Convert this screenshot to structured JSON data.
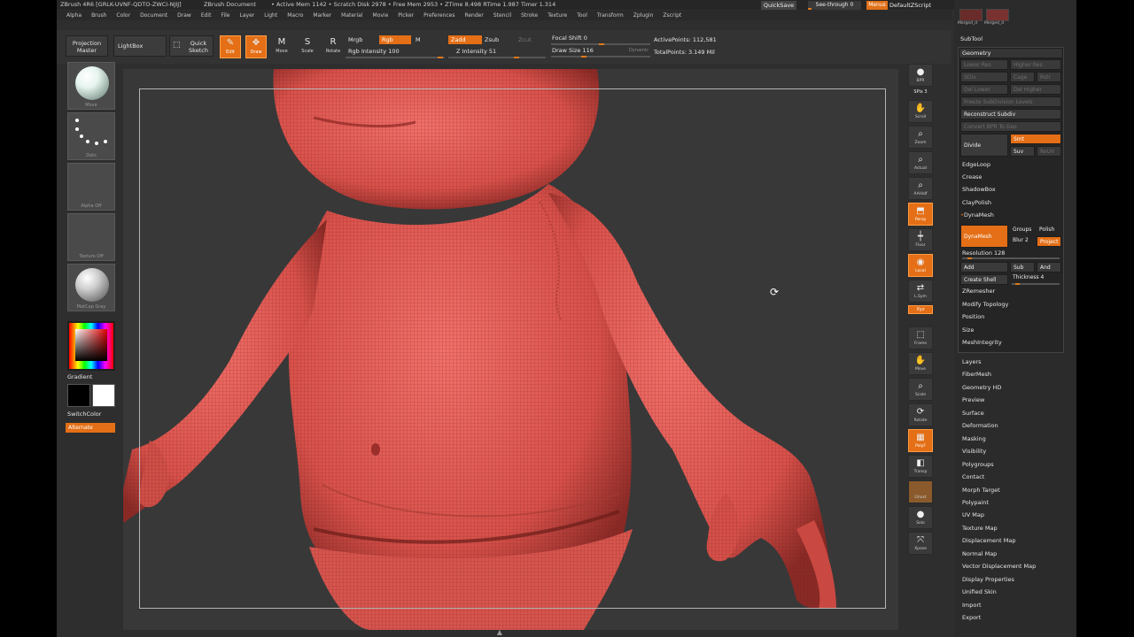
{
  "titlebar": {
    "app": "ZBrush 4R6 [GRLK-UVNF-QDTO-ZWCI-NJIJ]",
    "doc": "ZBrush Document",
    "mem": "• Active Mem 1142 • Scratch Disk 2978 • Free Mem 2953 • ZTime 8.498 RTime 1.987 Timer 1.314",
    "quicksave": "QuickSave",
    "seethrough": "See-through  0",
    "menus": "Menus",
    "defscript": "DefaultZScript",
    "winctl": "- ▫ ×"
  },
  "menubar": [
    "Alpha",
    "Brush",
    "Color",
    "Document",
    "Draw",
    "Edit",
    "File",
    "Layer",
    "Light",
    "Macro",
    "Marker",
    "Material",
    "Movie",
    "Picker",
    "Preferences",
    "Render",
    "Stencil",
    "Stroke",
    "Texture",
    "Tool",
    "Transform",
    "Zplugin",
    "Zscript"
  ],
  "shelf": {
    "projection_master": "Projection Master",
    "lightbox": "LightBox",
    "quick_sketch": "Quick Sketch",
    "tools": [
      {
        "label": "Edit",
        "icon": "✎",
        "active": true
      },
      {
        "label": "Draw",
        "icon": "✥",
        "active": true
      },
      {
        "label": "Move",
        "icon": "M",
        "active": false
      },
      {
        "label": "Scale",
        "icon": "S",
        "active": false
      },
      {
        "label": "Rotate",
        "icon": "R",
        "active": false
      }
    ],
    "mrgb": "Mrgb",
    "rgb": "Rgb",
    "m": "M",
    "rgb_intensity": "Rgb Intensity 100",
    "zadd": "Zadd",
    "zsub": "Zsub",
    "zcut": "Zcut",
    "z_intensity": "Z Intensity 51",
    "focal_shift": "Focal Shift 0",
    "draw_size": "Draw Size 116",
    "dynamic": "Dynamic",
    "active_points": "ActivePoints: 112,581",
    "total_points": "TotalPoints: 3.149 Mil"
  },
  "leftshelf": {
    "brush": "Move",
    "stroke": "Dots",
    "alpha": "Alpha Off",
    "texture": "Texture Off",
    "material": "MatCap Gray",
    "gradient": "Gradient",
    "switchcolor": "SwitchColor",
    "alternate": "Alternate"
  },
  "rightcol": [
    {
      "label": "BPR",
      "icon": "●",
      "state": "normal"
    },
    {
      "label": "SPix 3",
      "icon": "",
      "state": "text"
    },
    {
      "label": "Scroll",
      "icon": "✋",
      "state": "normal"
    },
    {
      "label": "Zoom",
      "icon": "⌕",
      "state": "normal"
    },
    {
      "label": "Actual",
      "icon": "⌕",
      "state": "normal"
    },
    {
      "label": "AAHalf",
      "icon": "⌕",
      "state": "normal"
    },
    {
      "label": "Persp",
      "icon": "⬒",
      "state": "orange"
    },
    {
      "label": "Floor",
      "icon": "┿",
      "state": "normal"
    },
    {
      "label": "Local",
      "icon": "◉",
      "state": "orange"
    },
    {
      "label": "L.Sym",
      "icon": "⇄",
      "state": "normal"
    },
    {
      "label": "Xyz",
      "icon": "",
      "state": "orange-small"
    },
    {
      "label": "Frame",
      "icon": "⬚",
      "state": "normal"
    },
    {
      "label": "Move",
      "icon": "✋",
      "state": "normal"
    },
    {
      "label": "Scale",
      "icon": "⌕",
      "state": "normal"
    },
    {
      "label": "Rotate",
      "icon": "⟳",
      "state": "normal"
    },
    {
      "label": "PolyF",
      "icon": "▦",
      "state": "orange"
    },
    {
      "label": "Transp",
      "icon": "◧",
      "state": "normal"
    },
    {
      "label": "Ghost",
      "icon": "",
      "state": "brown"
    },
    {
      "label": "Solo",
      "icon": "●",
      "state": "normal"
    },
    {
      "label": "Xpose",
      "icon": "⤧",
      "state": "normal"
    }
  ],
  "palette": {
    "merged1": "Merged_d",
    "merged2": "Merged_d",
    "subtool": "SubTool",
    "geometry": "Geometry",
    "lower_res": "Lower Res",
    "higher_res": "Higher Res",
    "sdiv": "SDiv",
    "cage": "Cage",
    "rstr": "Rstr",
    "del_lower": "Del Lower",
    "del_higher": "Del Higher",
    "freeze": "Freeze SubDivision Levels",
    "reconstruct": "Reconstruct Subdiv",
    "convert_bpr": "Convert BPR To Geo",
    "divide": "Divide",
    "smt": "Smt",
    "suv": "Suv",
    "reuv": "ReUV",
    "edgeloop": "EdgeLoop",
    "crease": "Crease",
    "shadowbox": "ShadowBox",
    "claypolish": "ClayPolish",
    "dynamesh_hdr": "DynaMesh",
    "dynamesh_btn": "DynaMesh",
    "groups": "Groups",
    "polish": "Polish",
    "blur": "Blur 2",
    "project": "Project",
    "resolution": "Resolution 128",
    "add": "Add",
    "sub": "Sub",
    "and": "And",
    "create_shell": "Create Shell",
    "thickness": "Thickness 4",
    "zremesher": "ZRemesher",
    "modify_topology": "Modify Topology",
    "position": "Position",
    "size": "Size",
    "meshintegrity": "MeshIntegrity",
    "sections": [
      "Layers",
      "FiberMesh",
      "Geometry HD",
      "Preview",
      "Surface",
      "Deformation",
      "Masking",
      "Visibility",
      "Polygroups",
      "Contact",
      "Morph Target",
      "Polypaint",
      "UV Map",
      "Texture Map",
      "Displacement Map",
      "Normal Map",
      "Vector Displacement Map",
      "Display Properties",
      "Unified Skin",
      "Import",
      "Export"
    ]
  },
  "colors": {
    "accent": "#e46f16",
    "mesh": "#e8605a",
    "bg": "#2e2e2e"
  }
}
